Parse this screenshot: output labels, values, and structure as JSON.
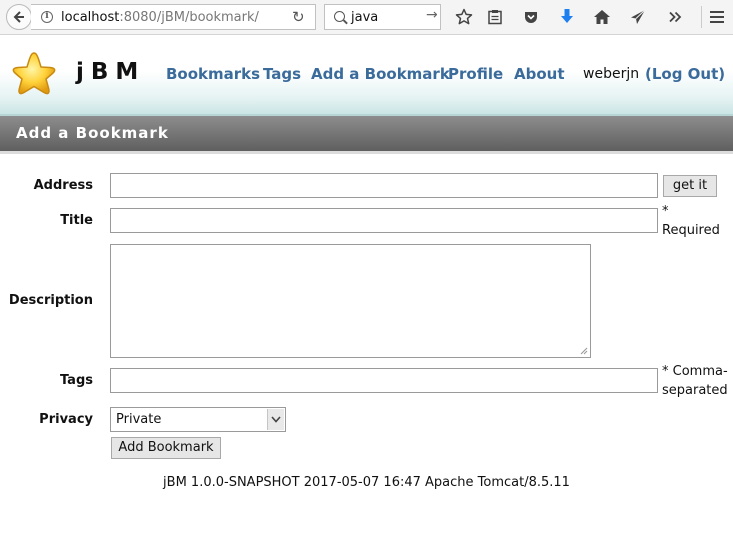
{
  "browser": {
    "url_host": "localhost",
    "url_path": ":8080/jBM/bookmark/",
    "search_value": "java"
  },
  "site": {
    "logo_text": "jBM",
    "nav": {
      "bookmarks": "Bookmarks",
      "tags": "Tags",
      "add_bookmark": "Add a Bookmark",
      "profile": "Profile",
      "about": "About"
    },
    "user": "weberjn",
    "logout": "(Log Out)"
  },
  "page": {
    "title": "Add a Bookmark"
  },
  "form": {
    "address_label": "Address",
    "address_value": "",
    "get_it_button": "get it",
    "title_label": "Title",
    "title_value": "",
    "title_note_star": "*",
    "title_note": "Required",
    "description_label": "Description",
    "description_value": "",
    "tags_label": "Tags",
    "tags_value": "",
    "tags_note_line1": "* Comma-",
    "tags_note_line2": "separated",
    "privacy_label": "Privacy",
    "privacy_value": "Private",
    "submit_button": "Add Bookmark"
  },
  "footer": {
    "text": "jBM 1.0.0-SNAPSHOT 2017-05-07 16:47 Apache Tomcat/8.5.11"
  },
  "colors": {
    "nav_link": "#3a6b9b",
    "title_bar": "#6f6f6f",
    "download_arrow": "#1e7ff0"
  }
}
